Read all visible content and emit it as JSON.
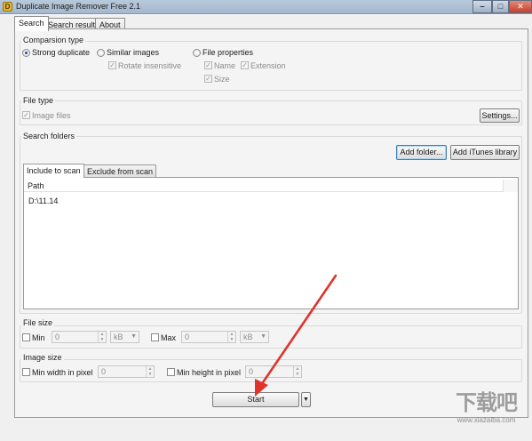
{
  "window": {
    "title": "Duplicate Image Remover Free 2.1",
    "min_symbol": "–",
    "max_symbol": "□",
    "close_symbol": "✕"
  },
  "tabs": [
    "Search",
    "Search result",
    "About"
  ],
  "comparison": {
    "title": "Comparsion type",
    "options": [
      {
        "label": "Strong duplicate",
        "checked": true
      },
      {
        "label": "Similar images",
        "checked": false
      },
      {
        "label": "File properties",
        "checked": false
      }
    ],
    "rotate_insensitive": "Rotate insensitive",
    "name": "Name",
    "extension": "Extension",
    "size": "Size"
  },
  "file_type": {
    "title": "File type",
    "image_files": "Image files",
    "settings_button": "Settings..."
  },
  "search_folders": {
    "title": "Search folders",
    "add_folder": "Add folder...",
    "add_itunes": "Add iTunes library",
    "tabs": [
      "Include to scan",
      "Exclude from scan"
    ],
    "column_header": "Path",
    "rows": [
      "D:\\11.14"
    ]
  },
  "file_size": {
    "title": "File size",
    "min_label": "Min",
    "min_value": "0",
    "min_unit": "kB",
    "max_label": "Max",
    "max_value": "0",
    "max_unit": "kB"
  },
  "image_size": {
    "title": "Image size",
    "min_width_label": "Min width in pixel",
    "min_width_value": "0",
    "min_height_label": "Min height in pixel",
    "min_height_value": "0"
  },
  "start_button": "Start",
  "watermark": {
    "glyphs": "下载吧",
    "url": "www.xiazaiba.com"
  },
  "colors": {
    "annotation_arrow": "#e0342b",
    "accent": "#1b4f9a"
  }
}
